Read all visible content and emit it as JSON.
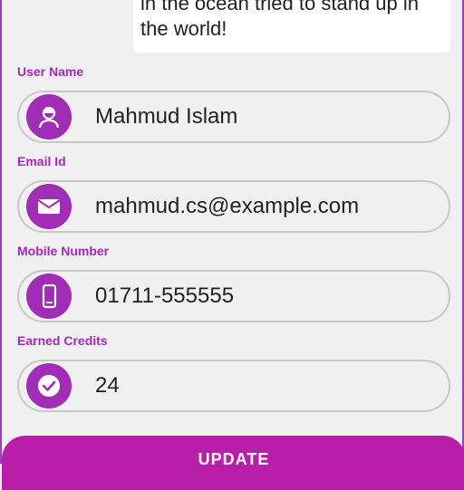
{
  "quote": {
    "text": "in the ocean tried to stand up in the world!"
  },
  "form": {
    "fields": [
      {
        "label": "User Name",
        "value": "Mahmud Islam",
        "icon": "user-icon"
      },
      {
        "label": "Email Id",
        "value": "mahmud.cs@example.com",
        "icon": "envelope-icon"
      },
      {
        "label": "Mobile Number",
        "value": "01711-555555",
        "icon": "mobile-phone-icon"
      },
      {
        "label": "Earned Credits",
        "value": "24",
        "icon": "check-circle-icon"
      }
    ]
  },
  "actions": {
    "update_label": "UPDATE"
  },
  "colors": {
    "accent": "#a12cb5",
    "button": "#b81ea8",
    "background": "#f0f0f0"
  }
}
